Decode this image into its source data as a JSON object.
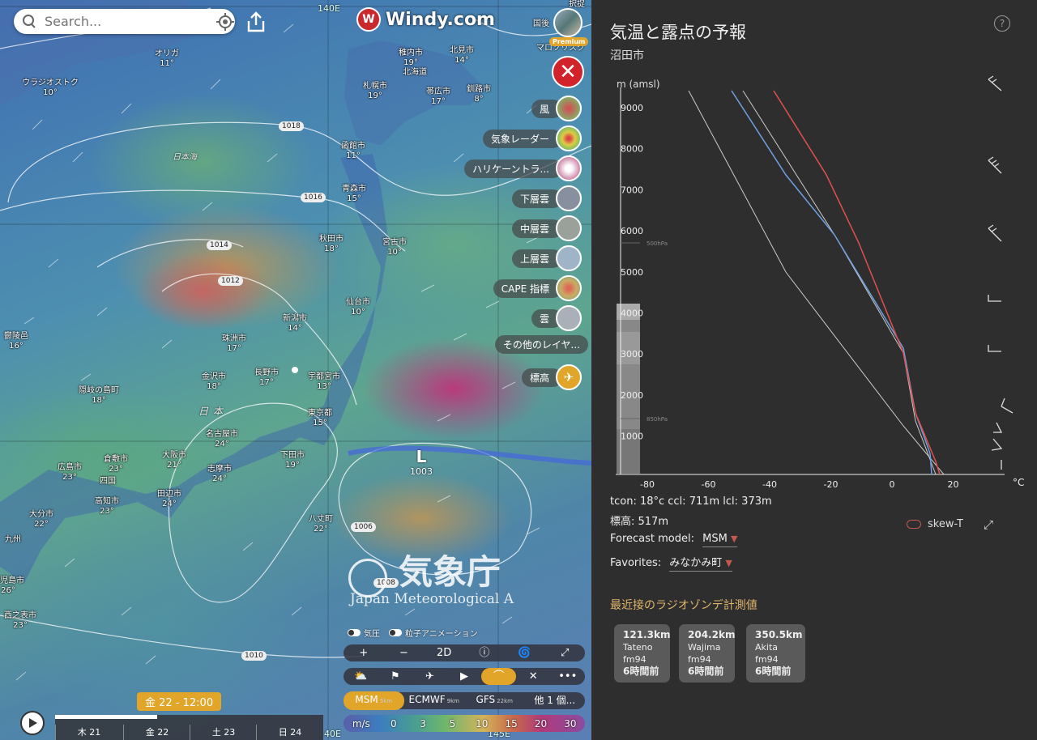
{
  "map": {
    "search": {
      "placeholder": "Search..."
    },
    "logo": {
      "text": "Windy.com"
    },
    "premium_badge": "Premium",
    "top_partial_labels": [
      "択捉",
      "国後",
      "マロソリスク"
    ],
    "longitudes": [
      "140E",
      "145E",
      "40E"
    ],
    "seas": [
      "日本海",
      "日本"
    ],
    "cities": [
      {
        "name": "オリガ",
        "temp": "11°"
      },
      {
        "name": "ウラジオストク",
        "temp": "10°"
      },
      {
        "name": "稚内市",
        "temp": "19°"
      },
      {
        "name": "北見市",
        "temp": "14°"
      },
      {
        "name": "北海道",
        "temp": ""
      },
      {
        "name": "札幌市",
        "temp": "19°"
      },
      {
        "name": "帯広市",
        "temp": "17°"
      },
      {
        "name": "釧路市",
        "temp": "8°"
      },
      {
        "name": "函館市",
        "temp": "11°"
      },
      {
        "name": "青森市",
        "temp": "15°"
      },
      {
        "name": "秋田市",
        "temp": "18°"
      },
      {
        "name": "宮古市",
        "temp": "10°"
      },
      {
        "name": "仙台市",
        "temp": "10°"
      },
      {
        "name": "新潟市",
        "temp": "14°"
      },
      {
        "name": "鬱陵邑",
        "temp": "16°"
      },
      {
        "name": "珠洲市",
        "temp": "17°"
      },
      {
        "name": "金沢市",
        "temp": "18°"
      },
      {
        "name": "長野市",
        "temp": "17°"
      },
      {
        "name": "宇都宮市",
        "temp": "13°"
      },
      {
        "name": "隠岐の島町",
        "temp": "18°"
      },
      {
        "name": "東京都",
        "temp": "15°"
      },
      {
        "name": "名古屋市",
        "temp": "24°"
      },
      {
        "name": "倉敷市",
        "temp": "23°"
      },
      {
        "name": "大阪市",
        "temp": "21°"
      },
      {
        "name": "広島市",
        "temp": "23°"
      },
      {
        "name": "四国",
        "temp": ""
      },
      {
        "name": "志摩市",
        "temp": "24°"
      },
      {
        "name": "下田市",
        "temp": "19°"
      },
      {
        "name": "高知市",
        "temp": "23°"
      },
      {
        "name": "田辺市",
        "temp": "24°"
      },
      {
        "name": "大分市",
        "temp": "22°"
      },
      {
        "name": "八丈町",
        "temp": "22°"
      },
      {
        "name": "九州",
        "temp": ""
      },
      {
        "name": "鹿児島市",
        "temp": "26°"
      },
      {
        "name": "西之表市",
        "temp": "23°"
      }
    ],
    "isobars": [
      "1018",
      "1016",
      "1014",
      "1012",
      "1006",
      "1010",
      "1008"
    ],
    "low": {
      "letter": "L",
      "value": "1003"
    },
    "layers": [
      "風",
      "気象レーダー",
      "ハリケーントラ...",
      "下層雲",
      "中層雲",
      "上層雲",
      "CAPE 指標",
      "雲",
      "その他のレイヤ...",
      "標高"
    ],
    "jma": {
      "kanji": "気象庁",
      "english": "Japan Meteorological A"
    },
    "toggles": [
      "気圧",
      "粒子アニメーション"
    ],
    "toolbar1": {
      "mode": "2D"
    },
    "models": [
      {
        "name": "MSM",
        "res": "5km"
      },
      {
        "name": "ECMWF",
        "res": "9km"
      },
      {
        "name": "GFS",
        "res": "22km"
      },
      {
        "name": "他 1 個...",
        "res": ""
      }
    ],
    "scale": {
      "unit": "m/s",
      "values": [
        "0",
        "3",
        "5",
        "10",
        "15",
        "20",
        "30"
      ]
    },
    "timeline": {
      "current": "金 22 - 12:00",
      "days": [
        "木 21",
        "金 22",
        "土 23",
        "日 24"
      ],
      "progress": 0.38
    }
  },
  "panel": {
    "title": "気温と露点の予報",
    "location": "沼田市",
    "ylabel": "m (amsl)",
    "y_ticks": [
      "9000",
      "8000",
      "7000",
      "6000",
      "5000",
      "4000",
      "3000",
      "2000",
      "1000"
    ],
    "x_ticks": [
      "-80",
      "-60",
      "-40",
      "-20",
      "0",
      "20"
    ],
    "x_unit": "°C",
    "pressure_labels": [
      "500hPa",
      "850hPa"
    ],
    "tcon": "tcon: 18°c ccl: 711m lcl: 373m",
    "elevation": "標高: 517m",
    "forecast_model_label": "Forecast model:",
    "forecast_model_value": "MSM",
    "favorites_label": "Favorites:",
    "favorites_value": "みなかみ町",
    "skewt_label": "skew-T",
    "radiosonde_heading": "最近接のラジオゾンデ計測値",
    "radiosondes": [
      {
        "distance": "121.3km",
        "station": "Tateno",
        "code": "fm94",
        "age": "6時間前"
      },
      {
        "distance": "204.2km",
        "station": "Wajima",
        "code": "fm94",
        "age": "6時間前"
      },
      {
        "distance": "350.5km",
        "station": "Akita",
        "code": "fm94",
        "age": "6時間前"
      }
    ],
    "colors": {
      "temperature": "#e05050",
      "dewpoint": "#6fa0e0",
      "parcel": "#cccccc",
      "accent": "#e1a52a"
    }
  }
}
